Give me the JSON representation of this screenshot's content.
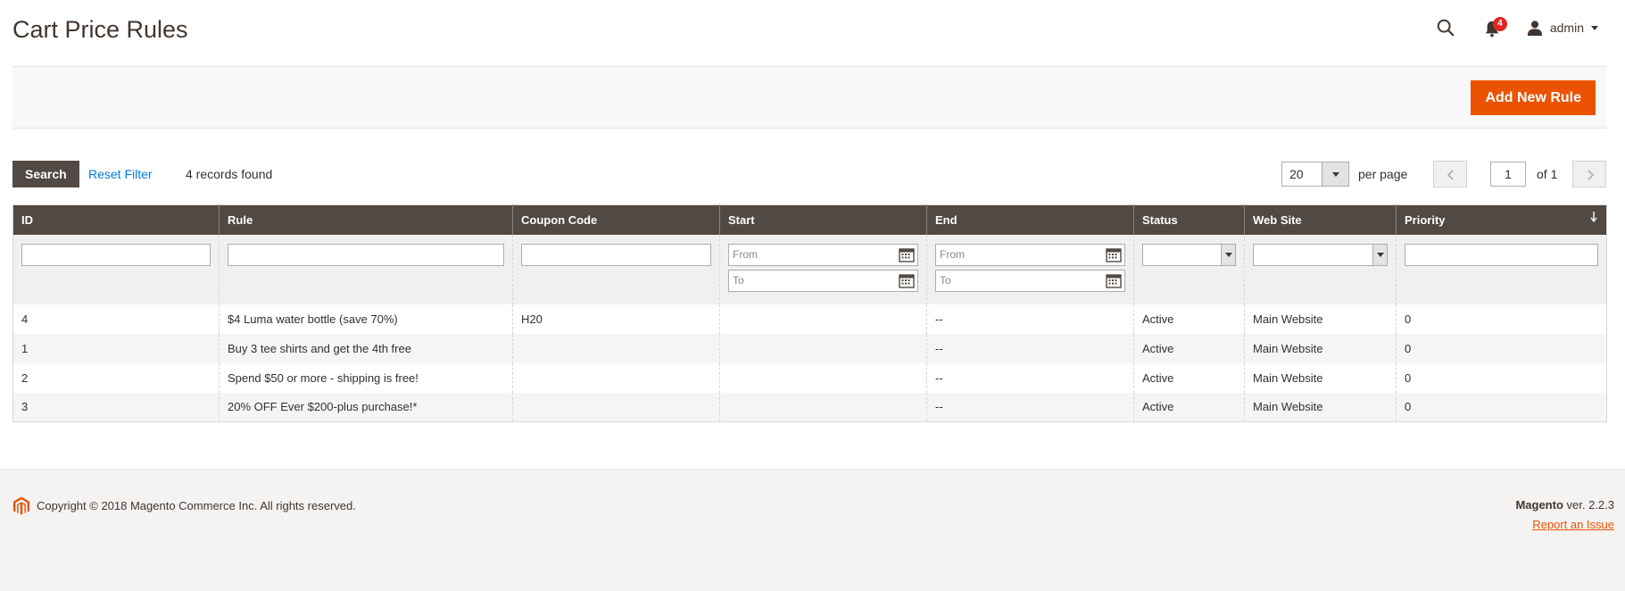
{
  "header": {
    "title": "Cart Price Rules",
    "notification_count": "4",
    "user_name": "admin"
  },
  "actions": {
    "add_new_rule": "Add New Rule"
  },
  "grid_controls": {
    "search_label": "Search",
    "reset_filter_label": "Reset Filter",
    "records_found": "4 records found",
    "per_page_value": "20",
    "per_page_label": "per page",
    "page_value": "1",
    "page_of": "of 1"
  },
  "table": {
    "columns": [
      "ID",
      "Rule",
      "Coupon Code",
      "Start",
      "End",
      "Status",
      "Web Site",
      "Priority"
    ],
    "filters": {
      "from_placeholder": "From",
      "to_placeholder": "To"
    },
    "rows": [
      {
        "id": "4",
        "rule": "$4 Luma water bottle (save 70%)",
        "coupon": "H20",
        "start": "",
        "end": "--",
        "status": "Active",
        "website": "Main Website",
        "priority": "0"
      },
      {
        "id": "1",
        "rule": "Buy 3 tee shirts and get the 4th free",
        "coupon": "",
        "start": "",
        "end": "--",
        "status": "Active",
        "website": "Main Website",
        "priority": "0"
      },
      {
        "id": "2",
        "rule": "Spend $50 or more - shipping is free!",
        "coupon": "",
        "start": "",
        "end": "--",
        "status": "Active",
        "website": "Main Website",
        "priority": "0"
      },
      {
        "id": "3",
        "rule": "20% OFF Ever $200-plus purchase!*",
        "coupon": "",
        "start": "",
        "end": "--",
        "status": "Active",
        "website": "Main Website",
        "priority": "0"
      }
    ]
  },
  "footer": {
    "copyright": "Copyright © 2018 Magento Commerce Inc. All rights reserved.",
    "brand": "Magento",
    "version": " ver. 2.2.3",
    "report_issue": "Report an Issue"
  },
  "colors": {
    "accent": "#eb5202",
    "header_dark": "#514943",
    "link": "#007bdb"
  }
}
